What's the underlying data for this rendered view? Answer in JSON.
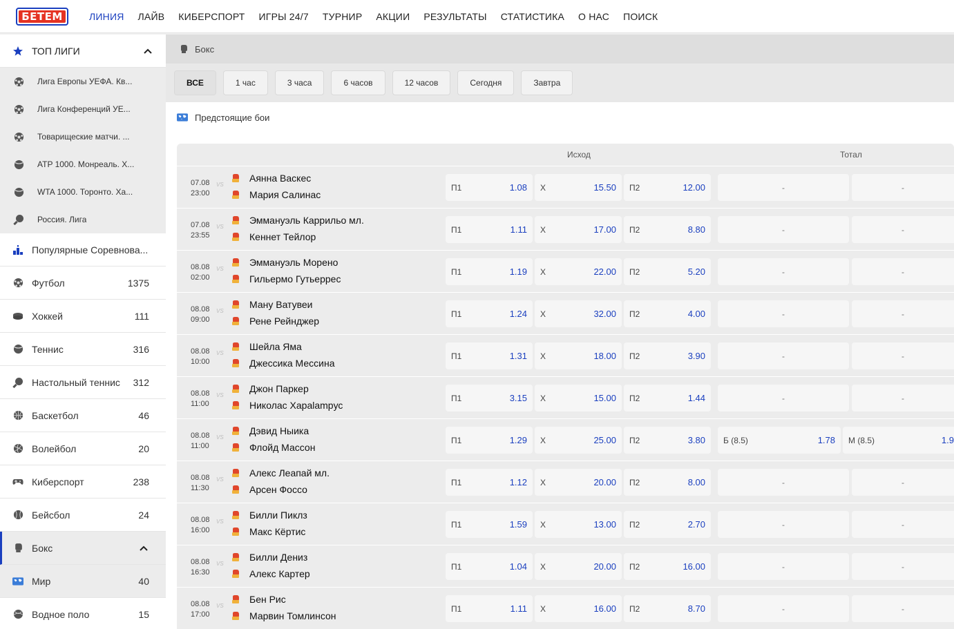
{
  "header": {
    "logo": "БЕТЕМ",
    "nav": [
      "ЛИНИЯ",
      "ЛАЙВ",
      "КИБЕРСПОРТ",
      "ИГРЫ 24/7",
      "ТУРНИР",
      "АКЦИИ",
      "РЕЗУЛЬТАТЫ",
      "СТАТИСТИКА",
      "О НАС",
      "ПОИСК"
    ],
    "active_nav": "ЛИНИЯ"
  },
  "sidebar": {
    "top_title": "ТОП ЛИГИ",
    "leagues": [
      {
        "label": "Лига Европы УЕФА. Кв...",
        "icon": "football-icon"
      },
      {
        "label": "Лига Конференций УЕ...",
        "icon": "football-icon"
      },
      {
        "label": "Товарищеские матчи. ...",
        "icon": "football-icon"
      },
      {
        "label": "ATP 1000. Монреаль. Х...",
        "icon": "tennis-icon"
      },
      {
        "label": "WTA 1000. Торонто. Ха...",
        "icon": "tennis-icon"
      },
      {
        "label": "Россия. Лига",
        "icon": "table-tennis-icon"
      }
    ],
    "sports": [
      {
        "label": "Популярные Соревнова...",
        "count": "",
        "icon": "podium-icon"
      },
      {
        "label": "Футбол",
        "count": "1375",
        "icon": "football-icon"
      },
      {
        "label": "Хоккей",
        "count": "111",
        "icon": "hockey-icon"
      },
      {
        "label": "Теннис",
        "count": "316",
        "icon": "tennis-icon"
      },
      {
        "label": "Настольный теннис",
        "count": "312",
        "icon": "table-tennis-icon"
      },
      {
        "label": "Баскетбол",
        "count": "46",
        "icon": "basketball-icon"
      },
      {
        "label": "Волейбол",
        "count": "20",
        "icon": "volleyball-icon"
      },
      {
        "label": "Киберспорт",
        "count": "238",
        "icon": "gamepad-icon"
      },
      {
        "label": "Бейсбол",
        "count": "24",
        "icon": "baseball-icon"
      },
      {
        "label": "Бокс",
        "count": "",
        "icon": "boxing-glove-icon",
        "active": true
      },
      {
        "label": "Мир",
        "count": "40",
        "icon": "world-map-icon",
        "sub": true
      },
      {
        "label": "Водное поло",
        "count": "15",
        "icon": "water-polo-icon"
      }
    ]
  },
  "main": {
    "breadcrumb": "Бокс",
    "filters": [
      "ВСЕ",
      "1 час",
      "3 часа",
      "6 часов",
      "12 часов",
      "Сегодня",
      "Завтра"
    ],
    "active_filter": "ВСЕ",
    "section_title": "Предстоящие бои",
    "col_outcome": "Исход",
    "col_total": "Тотал",
    "odd_labels": {
      "p1": "П1",
      "x": "Х",
      "p2": "П2"
    },
    "vs_label": "VS",
    "matches": [
      {
        "date": "07.08",
        "time": "23:00",
        "team1": "Аянна Васкес",
        "team2": "Мария Салинас",
        "p1": "1.08",
        "x": "15.50",
        "p2": "12.00",
        "total": null
      },
      {
        "date": "07.08",
        "time": "23:55",
        "team1": "Эммануэль Каррильо мл.",
        "team2": "Кеннет Тейлор",
        "p1": "1.11",
        "x": "17.00",
        "p2": "8.80",
        "total": null
      },
      {
        "date": "08.08",
        "time": "02:00",
        "team1": "Эммануэль Морено",
        "team2": "Гильермо Гутьеррес",
        "p1": "1.19",
        "x": "22.00",
        "p2": "5.20",
        "total": null
      },
      {
        "date": "08.08",
        "time": "09:00",
        "team1": "Ману Ватувеи",
        "team2": "Рене Рейнджер",
        "p1": "1.24",
        "x": "32.00",
        "p2": "4.00",
        "total": null
      },
      {
        "date": "08.08",
        "time": "10:00",
        "team1": "Шейла Яма",
        "team2": "Джессика Мессина",
        "p1": "1.31",
        "x": "18.00",
        "p2": "3.90",
        "total": null
      },
      {
        "date": "08.08",
        "time": "11:00",
        "team1": "Джон Паркер",
        "team2": "Николас Хараlampус",
        "p1": "3.15",
        "x": "15.00",
        "p2": "1.44",
        "total": null
      },
      {
        "date": "08.08",
        "time": "11:00",
        "team1": "Дэвид Ныика",
        "team2": "Флойд Массон",
        "p1": "1.29",
        "x": "25.00",
        "p2": "3.80",
        "total": {
          "over_label": "Б (8.5)",
          "over": "1.78",
          "under_label": "М (8.5)",
          "under": "1.9"
        }
      },
      {
        "date": "08.08",
        "time": "11:30",
        "team1": "Алекс Леапай мл.",
        "team2": "Арсен Фоссо",
        "p1": "1.12",
        "x": "20.00",
        "p2": "8.00",
        "total": null
      },
      {
        "date": "08.08",
        "time": "16:00",
        "team1": "Билли Пиклз",
        "team2": "Макс Кёртис",
        "p1": "1.59",
        "x": "13.00",
        "p2": "2.70",
        "total": null
      },
      {
        "date": "08.08",
        "time": "16:30",
        "team1": "Билли Дениз",
        "team2": "Алекс Картер",
        "p1": "1.04",
        "x": "20.00",
        "p2": "16.00",
        "total": null
      },
      {
        "date": "08.08",
        "time": "17:00",
        "team1": "Бен Рис",
        "team2": "Марвин Томлинсон",
        "p1": "1.11",
        "x": "16.00",
        "p2": "8.70",
        "total": null
      }
    ],
    "dash": "-"
  },
  "colors": {
    "accent": "#1a3fbf",
    "logo_red": "#e53323"
  }
}
